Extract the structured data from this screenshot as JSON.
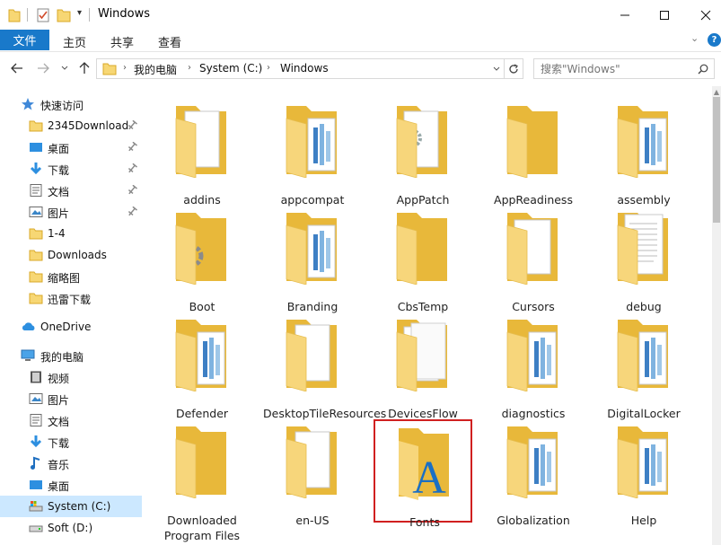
{
  "window": {
    "title": "Windows"
  },
  "ribbon": {
    "file": "文件",
    "tabs": [
      "主页",
      "共享",
      "查看"
    ]
  },
  "address": {
    "crumbs": [
      "我的电脑",
      "System (C:)",
      "Windows"
    ]
  },
  "search": {
    "placeholder": "搜索\"Windows\""
  },
  "sidebar": {
    "quick_access": "快速访问",
    "quick_items": [
      "2345Download",
      "桌面",
      "下载",
      "文档",
      "图片",
      "1-4",
      "Downloads",
      "缩略图",
      "迅雷下载"
    ],
    "onedrive": "OneDrive",
    "this_pc": "我的电脑",
    "pc_items": [
      "视频",
      "图片",
      "文档",
      "下载",
      "音乐",
      "桌面",
      "System (C:)",
      "Soft (D:)"
    ]
  },
  "folders": [
    {
      "name": "addins",
      "style": "doc"
    },
    {
      "name": "appcompat",
      "style": "striped"
    },
    {
      "name": "AppPatch",
      "style": "gear-doc"
    },
    {
      "name": "AppReadiness",
      "style": "plain"
    },
    {
      "name": "assembly",
      "style": "striped"
    },
    {
      "name": "Boot",
      "style": "gear"
    },
    {
      "name": "Branding",
      "style": "striped"
    },
    {
      "name": "CbsTemp",
      "style": "plain"
    },
    {
      "name": "Cursors",
      "style": "cursor-doc"
    },
    {
      "name": "debug",
      "style": "text-doc"
    },
    {
      "name": "Defender",
      "style": "striped"
    },
    {
      "name": "DesktopTileResources",
      "style": "doc"
    },
    {
      "name": "DevicesFlow",
      "style": "papers"
    },
    {
      "name": "diagnostics",
      "style": "striped"
    },
    {
      "name": "DigitalLocker",
      "style": "striped"
    },
    {
      "name": "Downloaded Program Files",
      "style": "plain"
    },
    {
      "name": "en-US",
      "style": "doc"
    },
    {
      "name": "Fonts",
      "style": "fonts"
    },
    {
      "name": "Globalization",
      "style": "striped"
    },
    {
      "name": "Help",
      "style": "striped"
    }
  ]
}
